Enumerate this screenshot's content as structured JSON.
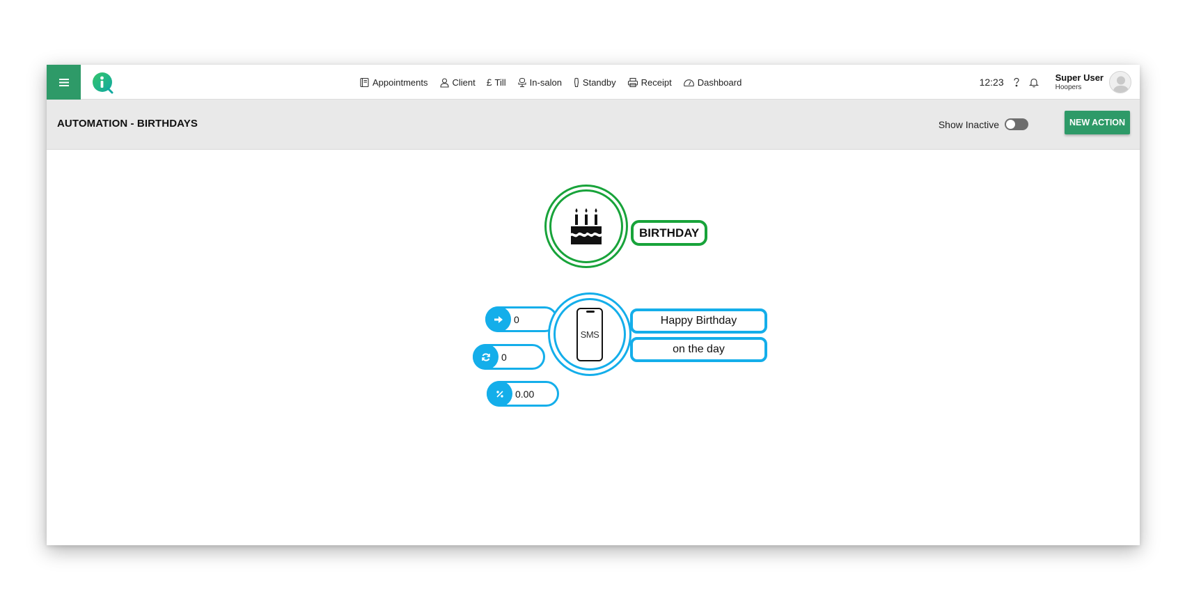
{
  "nav": {
    "items": [
      {
        "label": "Appointments",
        "icon": "book-icon"
      },
      {
        "label": "Client",
        "icon": "person-icon"
      },
      {
        "label": "Till",
        "icon": "pound-icon"
      },
      {
        "label": "In-salon",
        "icon": "salon-chair-icon"
      },
      {
        "label": "Standby",
        "icon": "standby-icon"
      },
      {
        "label": "Receipt",
        "icon": "printer-icon"
      },
      {
        "label": "Dashboard",
        "icon": "gauge-icon"
      }
    ],
    "clock": "12:23",
    "user": {
      "name": "Super User",
      "org": "Hoopers"
    }
  },
  "page": {
    "title": "AUTOMATION - BIRTHDAYS",
    "show_inactive_label": "Show Inactive",
    "show_inactive_on": false,
    "new_action_label": "NEW ACTION"
  },
  "automation": {
    "trigger": {
      "label": "BIRTHDAY",
      "icon": "birthday-cake-icon"
    },
    "action": {
      "channel": "SMS",
      "icon": "mobile-phone-icon",
      "message": "Happy Birthday",
      "timing": "on the day",
      "stats": [
        {
          "icon": "arrow-right-icon",
          "value": "0"
        },
        {
          "icon": "refresh-icon",
          "value": "0"
        },
        {
          "icon": "percent-icon",
          "value": "0.00"
        }
      ]
    }
  },
  "colors": {
    "brand_green": "#2e9a68",
    "trigger_green": "#18a33a",
    "action_blue": "#14aeea",
    "header_grey": "#e9e9e9"
  }
}
